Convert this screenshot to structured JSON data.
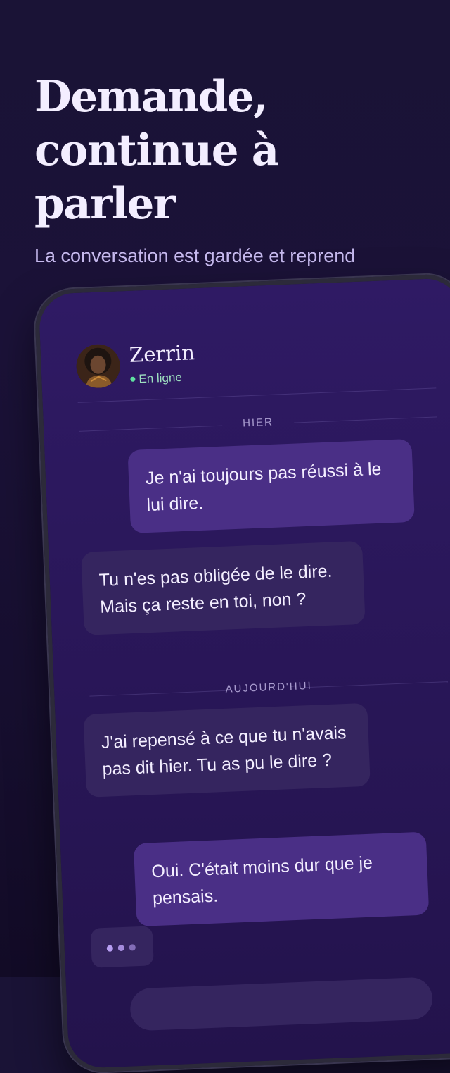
{
  "hero": {
    "headline_lines": [
      "Demande,",
      "continue à",
      "parler"
    ],
    "subtitle": "La conversation est gardée et reprend"
  },
  "chat": {
    "contact": {
      "name": "Zerrin",
      "status": "En ligne",
      "status_color": "#5fe0a0"
    },
    "separators": [
      "HIER",
      "AUJOURD'HUI"
    ],
    "messages": [
      {
        "from": "me",
        "text": "Je n'ai toujours pas réussi à le lui dire."
      },
      {
        "from": "contact",
        "text": "Tu n'es pas obligée de le dire. Mais ça reste en toi, non ?"
      },
      {
        "from": "contact",
        "text": "J'ai repensé à ce que tu n'avais pas dit hier. Tu as pu le dire ?"
      },
      {
        "from": "me",
        "text": "Oui. C'était moins dur que je pensais."
      }
    ]
  },
  "colors": {
    "background": "#1a1336",
    "headline": "#f3eeff",
    "subtitle": "#c6b9ee",
    "outgoing_bubble": "#4a2f86",
    "incoming_bubble": "#35255f",
    "accent": "#b79ef2"
  }
}
